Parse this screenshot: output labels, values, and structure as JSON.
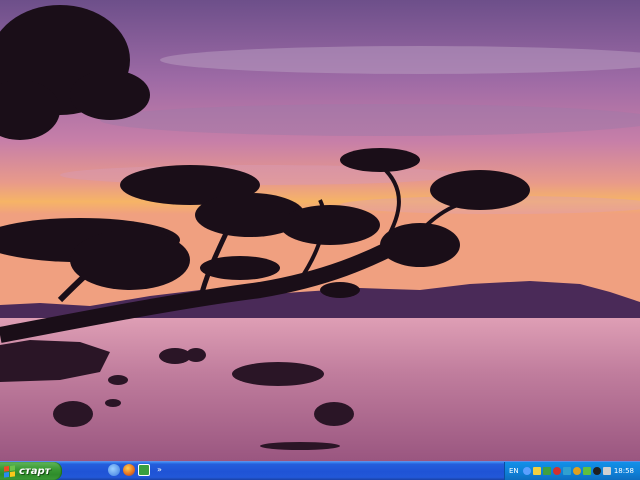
{
  "taskbar": {
    "start_label": "старт",
    "quick_launch": [
      {
        "icon": "ie-icon",
        "color": "#3a7be0"
      },
      {
        "icon": "firefox-icon",
        "color": "#e86a1a"
      },
      {
        "icon": "app-icon",
        "color": "#3aa040"
      }
    ],
    "quick_launch_more": "»",
    "tray": {
      "language": "EN",
      "icons": [
        {
          "icon": "back-arrow-icon",
          "color": "#5aa0ff"
        },
        {
          "icon": "network-icon",
          "color": "#f0d040"
        },
        {
          "icon": "security-icon",
          "color": "#40a040"
        },
        {
          "icon": "antivirus-icon",
          "color": "#d03030"
        },
        {
          "icon": "messenger-icon",
          "color": "#30a0d0"
        },
        {
          "icon": "update-icon",
          "color": "#e0a020"
        },
        {
          "icon": "chat-icon",
          "color": "#60c040"
        },
        {
          "icon": "settings-icon",
          "color": "#202020"
        },
        {
          "icon": "volume-icon",
          "color": "#d0d0d0"
        }
      ],
      "clock": "18:58"
    }
  }
}
